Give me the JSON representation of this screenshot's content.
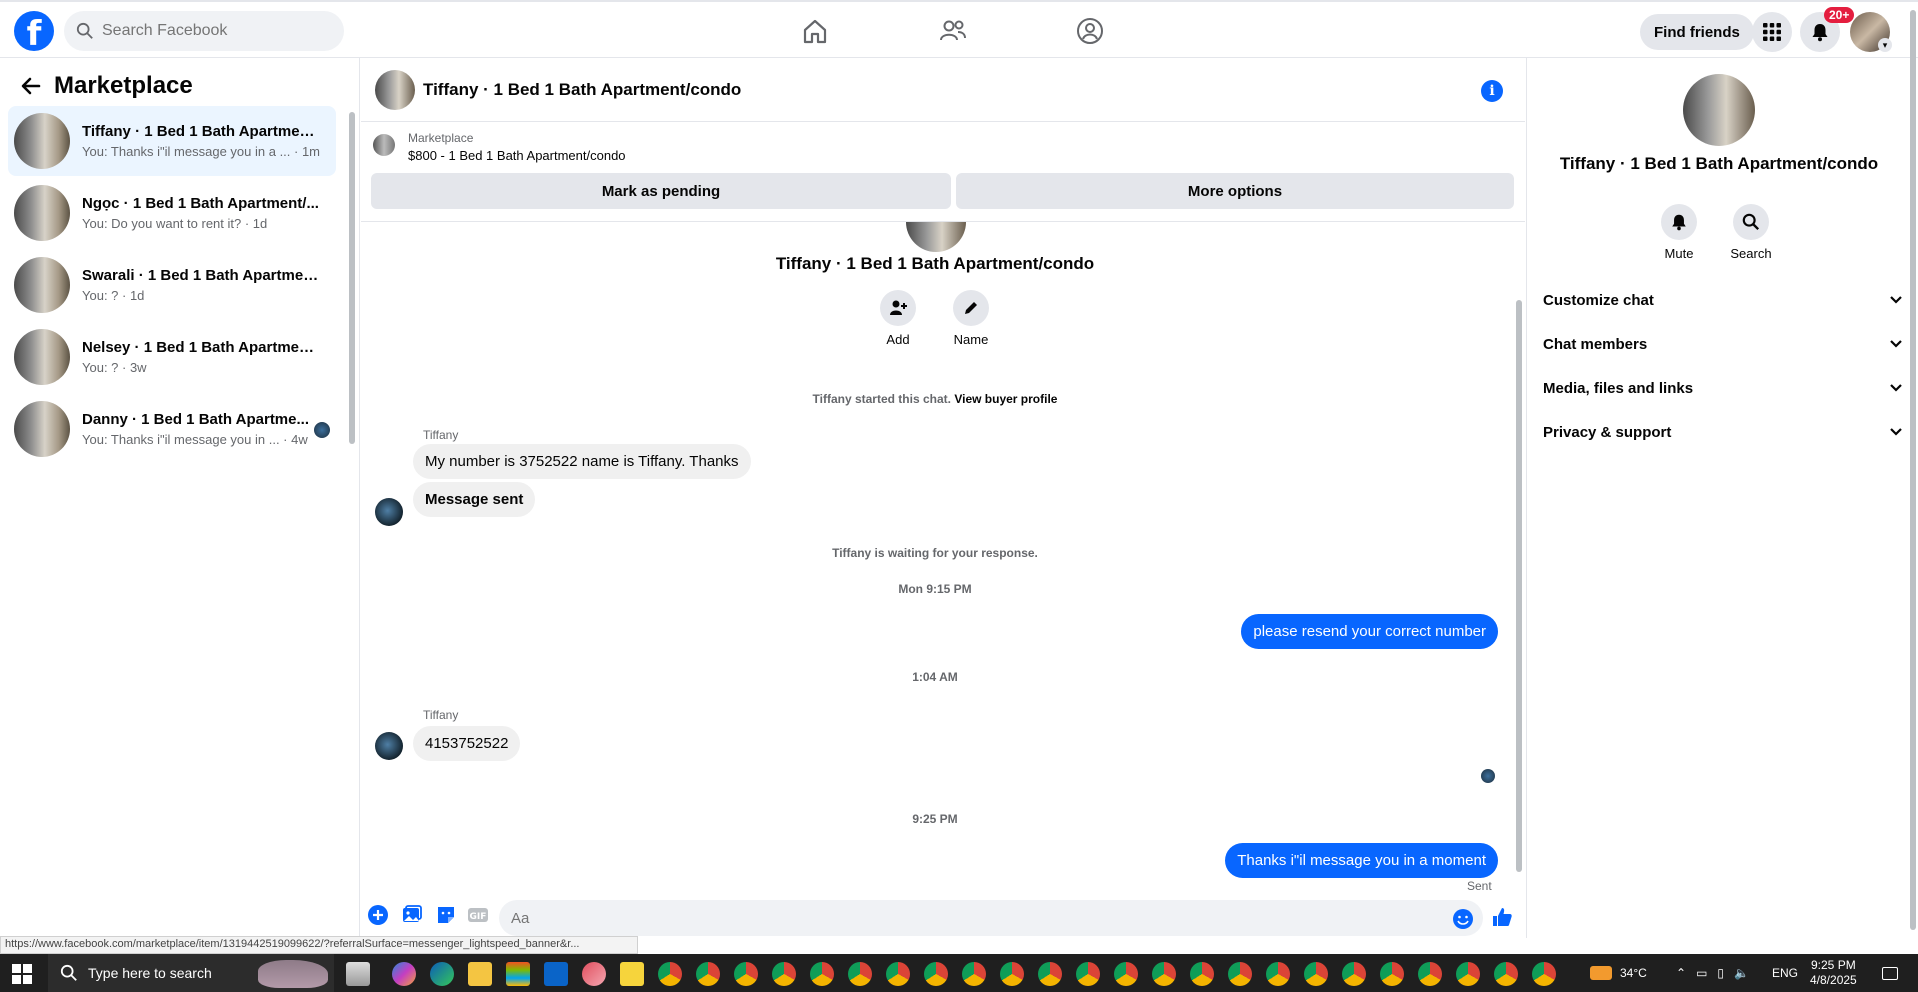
{
  "topnav": {
    "logo": "f",
    "search_placeholder": "Search Facebook",
    "find_friends": "Find friends",
    "notif_badge": "20+"
  },
  "sidebar": {
    "title": "Marketplace",
    "conversations": [
      {
        "name": "Tiffany · 1 Bed 1 Bath Apartment...",
        "preview": "You: Thanks i\"il message you in a ... · 1m"
      },
      {
        "name": "Ngọc · 1 Bed 1 Bath Apartment/...",
        "preview": "You: Do you want to rent it? · 1d"
      },
      {
        "name": "Swarali · 1 Bed 1 Bath Apartment...",
        "preview": "You: ? · 1d"
      },
      {
        "name": "Nelsey · 1 Bed 1 Bath Apartment...",
        "preview": "You: ? · 3w"
      },
      {
        "name": "Danny · 1 Bed 1 Bath Apartme...",
        "preview": "You: Thanks i\"il message you in ... · 4w"
      }
    ]
  },
  "chat": {
    "title": "Tiffany · 1 Bed 1 Bath Apartment/condo",
    "listing_source": "Marketplace",
    "listing_price": "$800 - 1 Bed 1 Bath Apartment/condo",
    "mark_pending": "Mark as pending",
    "more_options": "More options",
    "center_name": "Tiffany · 1 Bed 1 Bath Apartment/condo",
    "add_label": "Add",
    "name_label": "Name",
    "started_text": "Tiffany started this chat.",
    "view_profile": "View buyer profile",
    "sender1": "Tiffany",
    "msg1": "My number is 3752522 name is Tiffany. Thanks",
    "msg2": "Message sent",
    "waiting": "Tiffany is waiting for your response.",
    "time1": "Mon 9:15 PM",
    "out1": "please resend your correct number",
    "time2": "1:04 AM",
    "sender2": "Tiffany",
    "msg3": "4153752522",
    "time3": "9:25 PM",
    "out2": "Thanks i\"il message you in a moment",
    "sent": "Sent",
    "composer_placeholder": "Aa"
  },
  "rpanel": {
    "name": "Tiffany · 1 Bed 1 Bath Apartment/condo",
    "mute": "Mute",
    "search": "Search",
    "rows": [
      "Customize chat",
      "Chat members",
      "Media, files and links",
      "Privacy & support"
    ]
  },
  "statusbar": {
    "url": "https://www.facebook.com/marketplace/item/1319442519099622/?referralSurface=messenger_lightspeed_banner&r..."
  },
  "taskbar": {
    "search_text": "Type here to search",
    "temp": "34°C",
    "lang": "ENG",
    "time": "9:25 PM",
    "date": "4/8/2025"
  },
  "colors": {
    "accent": "#0866ff",
    "badge": "#e41e3f"
  }
}
